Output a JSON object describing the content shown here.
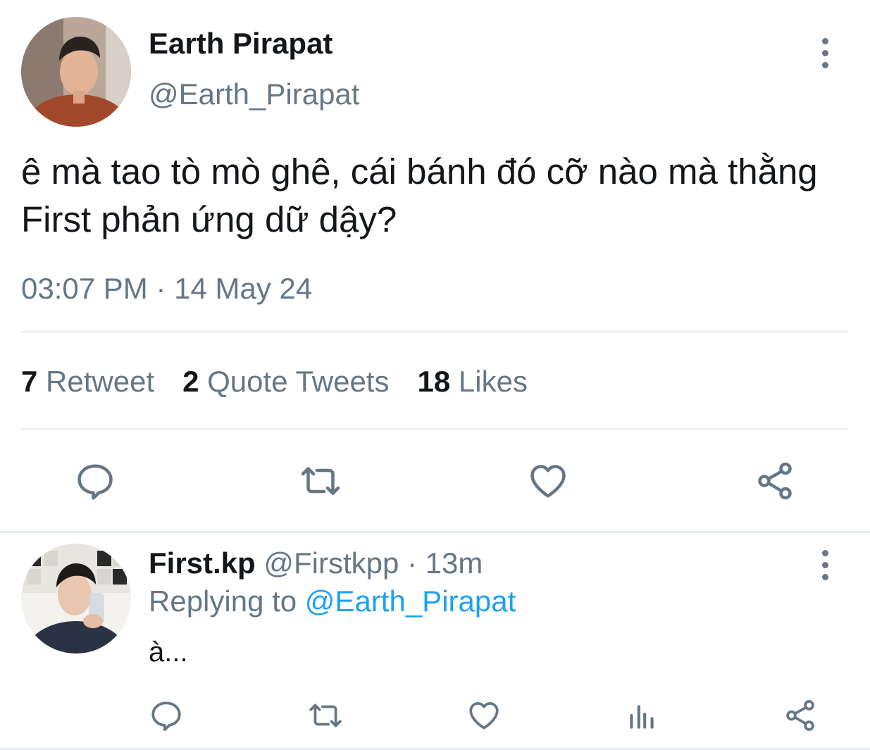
{
  "main_tweet": {
    "display_name": "Earth Pirapat",
    "handle": "@Earth_Pirapat",
    "text": "ê mà tao tò mò ghê, cái bánh đó cỡ nào mà thằng First phản ứng dữ dậy?",
    "timestamp": "03:07 PM · 14 May 24",
    "stats": {
      "retweets_count": "7",
      "retweets_label": "Retweet",
      "quotes_count": "2",
      "quotes_label": "Quote Tweets",
      "likes_count": "18",
      "likes_label": "Likes"
    },
    "actions": [
      "reply-icon",
      "retweet-icon",
      "like-icon",
      "share-icon"
    ]
  },
  "reply": {
    "display_name": "First.kp",
    "handle_time": "@Firstkpp · 13m",
    "replying_prefix": "Replying to",
    "replying_to": "@Earth_Pirapat",
    "text": "à...",
    "actions": [
      "reply-icon",
      "retweet-icon",
      "like-icon",
      "analytics-icon",
      "share-icon"
    ]
  },
  "colors": {
    "text_primary": "#14171a",
    "text_secondary": "#657786",
    "link": "#1da1f2",
    "divider": "#e6ecf0"
  }
}
